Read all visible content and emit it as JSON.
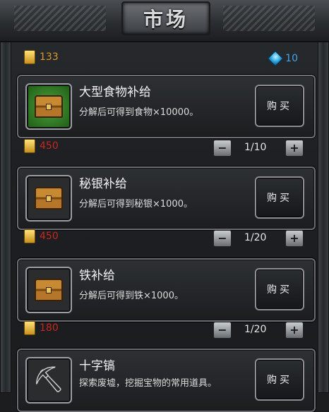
{
  "header": {
    "title": "市场"
  },
  "currency": {
    "gold": "133",
    "gems": "10"
  },
  "items": [
    {
      "name": "大型食物补给",
      "desc": "分解后可得到食物×10000。",
      "icon": "chest-icon",
      "buy": "购买",
      "price": "450",
      "qty": "1/10"
    },
    {
      "name": "秘银补给",
      "desc": "分解后可得到秘银×1000。",
      "icon": "chest-icon",
      "buy": "购买",
      "price": "450",
      "qty": "1/20"
    },
    {
      "name": "铁补给",
      "desc": "分解后可得到铁×1000。",
      "icon": "chest-icon",
      "buy": "购买",
      "price": "180",
      "qty": "1/20"
    },
    {
      "name": "十字镐",
      "desc": "探索废墟，挖掘宝物的常用道具。",
      "icon": "pickaxe-icon",
      "buy": "购买"
    }
  ],
  "colors": {
    "gold": "#d99a2a",
    "gem": "#3ea8e8",
    "price": "#c8261e"
  }
}
